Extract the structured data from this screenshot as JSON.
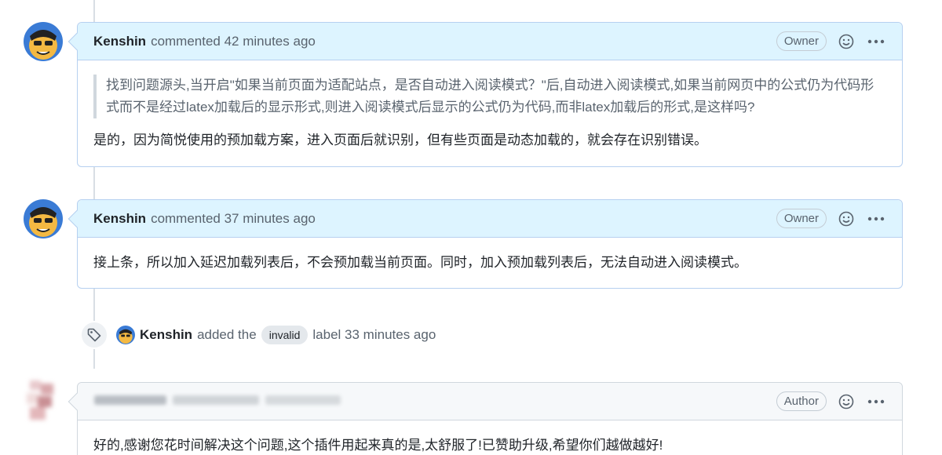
{
  "comments": [
    {
      "author": "Kenshin",
      "meta": "commented 42 minutes ago",
      "role": "Owner",
      "quote": "找到问题源头,当开启\"如果当前页面为适配站点，是否自动进入阅读模式？\"后,自动进入阅读模式,如果当前网页中的公式仍为代码形式而不是经过latex加载后的显示形式,则进入阅读模式后显示的公式仍为代码,而非latex加载后的形式,是这样吗?",
      "body": "是的，因为简悦使用的预加载方案，进入页面后就识别，但有些页面是动态加载的，就会存在识别错误。"
    },
    {
      "author": "Kenshin",
      "meta": "commented 37 minutes ago",
      "role": "Owner",
      "body": "接上条，所以加入延迟加载列表后，不会预加载当前页面。同时，加入预加载列表后，无法自动进入阅读模式。"
    },
    {
      "role": "Author",
      "body": "好的,感谢您花时间解决这个问题,这个插件用起来真的是,太舒服了!已赞助升级,希望你们越做越好!"
    }
  ],
  "event": {
    "actor": "Kenshin",
    "action": "added the",
    "label": "invalid",
    "suffix": "label 33 minutes ago"
  },
  "icons": {
    "emoji": "smiley-icon",
    "menu": "kebab-horizontal-icon",
    "tag": "tag-icon"
  },
  "colors": {
    "owner_header": "#ddf4ff",
    "owner_border": "#b6d0f0",
    "author_header": "#f6f8fa",
    "timeline": "#d8dee4",
    "label_bg": "#e4e8ec"
  }
}
